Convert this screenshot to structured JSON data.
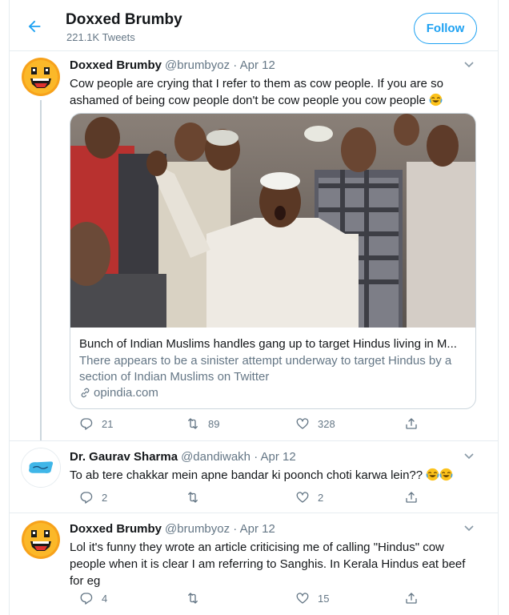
{
  "header": {
    "name": "Doxxed Brumby",
    "tweet_count": "221.1K Tweets",
    "follow_label": "Follow"
  },
  "tweets": [
    {
      "name": "Doxxed Brumby",
      "meta": "@brumbyoz · Apr 12",
      "avatar": "smiley-face-avatar",
      "text": "Cow people are crying that I refer to them as cow people. If you are so ashamed of being cow people don't be cow people you cow people",
      "emoji": [
        "joy-emoji"
      ],
      "card": {
        "title": "Bunch of Indian Muslims handles gang up to target Hindus living in M...",
        "description": "There appears to be a sinister attempt underway to target Hindus by a section of Indian Muslims on Twitter",
        "domain": "opindia.com"
      },
      "replies": "21",
      "retweets": "89",
      "likes": "328"
    },
    {
      "name": "Dr. Gaurav Sharma",
      "meta": "@dandiwakh · Apr 12",
      "avatar": "blue-logo-avatar",
      "text": "To ab tere chakkar mein apne bandar ki poonch choti karwa lein??",
      "emoji": [
        "joy-emoji",
        "joy-emoji"
      ],
      "replies": "2",
      "retweets": "",
      "likes": "2"
    },
    {
      "name": "Doxxed Brumby",
      "meta": "@brumbyoz · Apr 12",
      "avatar": "smiley-face-avatar",
      "text": "Lol it's funny they wrote an article criticising me of calling \"Hindus\" cow people when it is clear I am referring to Sanghis. In Kerala Hindus eat beef for eg",
      "replies": "4",
      "retweets": "",
      "likes": "15"
    }
  ],
  "colors": {
    "accent": "#1da1f2",
    "text": "#14171a",
    "muted": "#657786",
    "border": "#e6ecf0"
  }
}
